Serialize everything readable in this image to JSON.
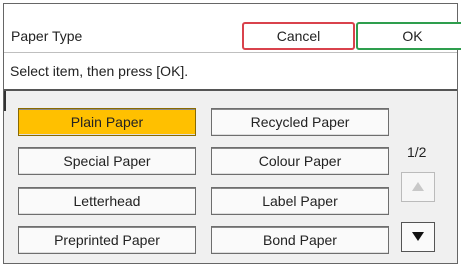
{
  "header": {
    "title": "Paper Type",
    "cancel_label": "Cancel",
    "ok_label": "OK"
  },
  "prompt": "Select item, then press [OK].",
  "options": [
    {
      "label": "Plain Paper",
      "selected": true
    },
    {
      "label": "Recycled Paper",
      "selected": false
    },
    {
      "label": "Special Paper",
      "selected": false
    },
    {
      "label": "Colour Paper",
      "selected": false
    },
    {
      "label": "Letterhead",
      "selected": false
    },
    {
      "label": "Label Paper",
      "selected": false
    },
    {
      "label": "Preprinted Paper",
      "selected": false
    },
    {
      "label": "Bond Paper",
      "selected": false
    }
  ],
  "pager": {
    "indicator": "1/2",
    "up_icon": "up-triangle-icon",
    "down_icon": "down-triangle-icon",
    "up_enabled": false,
    "down_enabled": true
  },
  "colors": {
    "selected": "#ffc000",
    "cancel_border": "#d9424c",
    "ok_border": "#2e9e4d"
  }
}
